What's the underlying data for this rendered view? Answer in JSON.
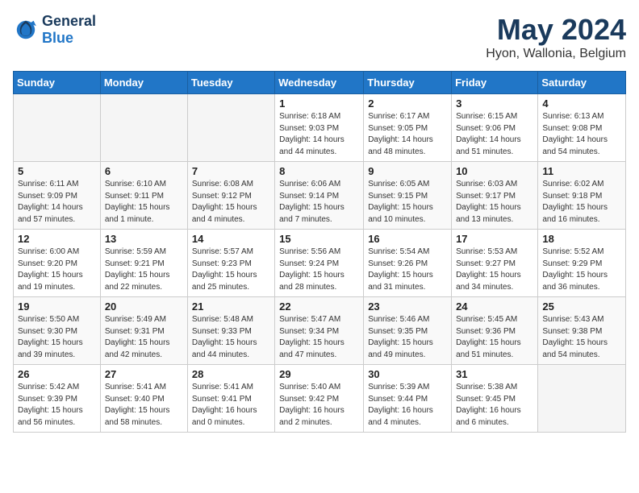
{
  "header": {
    "logo_general": "General",
    "logo_blue": "Blue",
    "month_title": "May 2024",
    "location": "Hyon, Wallonia, Belgium"
  },
  "weekdays": [
    "Sunday",
    "Monday",
    "Tuesday",
    "Wednesday",
    "Thursday",
    "Friday",
    "Saturday"
  ],
  "weeks": [
    [
      {
        "day": "",
        "info": ""
      },
      {
        "day": "",
        "info": ""
      },
      {
        "day": "",
        "info": ""
      },
      {
        "day": "1",
        "info": "Sunrise: 6:18 AM\nSunset: 9:03 PM\nDaylight: 14 hours\nand 44 minutes."
      },
      {
        "day": "2",
        "info": "Sunrise: 6:17 AM\nSunset: 9:05 PM\nDaylight: 14 hours\nand 48 minutes."
      },
      {
        "day": "3",
        "info": "Sunrise: 6:15 AM\nSunset: 9:06 PM\nDaylight: 14 hours\nand 51 minutes."
      },
      {
        "day": "4",
        "info": "Sunrise: 6:13 AM\nSunset: 9:08 PM\nDaylight: 14 hours\nand 54 minutes."
      }
    ],
    [
      {
        "day": "5",
        "info": "Sunrise: 6:11 AM\nSunset: 9:09 PM\nDaylight: 14 hours\nand 57 minutes."
      },
      {
        "day": "6",
        "info": "Sunrise: 6:10 AM\nSunset: 9:11 PM\nDaylight: 15 hours\nand 1 minute."
      },
      {
        "day": "7",
        "info": "Sunrise: 6:08 AM\nSunset: 9:12 PM\nDaylight: 15 hours\nand 4 minutes."
      },
      {
        "day": "8",
        "info": "Sunrise: 6:06 AM\nSunset: 9:14 PM\nDaylight: 15 hours\nand 7 minutes."
      },
      {
        "day": "9",
        "info": "Sunrise: 6:05 AM\nSunset: 9:15 PM\nDaylight: 15 hours\nand 10 minutes."
      },
      {
        "day": "10",
        "info": "Sunrise: 6:03 AM\nSunset: 9:17 PM\nDaylight: 15 hours\nand 13 minutes."
      },
      {
        "day": "11",
        "info": "Sunrise: 6:02 AM\nSunset: 9:18 PM\nDaylight: 15 hours\nand 16 minutes."
      }
    ],
    [
      {
        "day": "12",
        "info": "Sunrise: 6:00 AM\nSunset: 9:20 PM\nDaylight: 15 hours\nand 19 minutes."
      },
      {
        "day": "13",
        "info": "Sunrise: 5:59 AM\nSunset: 9:21 PM\nDaylight: 15 hours\nand 22 minutes."
      },
      {
        "day": "14",
        "info": "Sunrise: 5:57 AM\nSunset: 9:23 PM\nDaylight: 15 hours\nand 25 minutes."
      },
      {
        "day": "15",
        "info": "Sunrise: 5:56 AM\nSunset: 9:24 PM\nDaylight: 15 hours\nand 28 minutes."
      },
      {
        "day": "16",
        "info": "Sunrise: 5:54 AM\nSunset: 9:26 PM\nDaylight: 15 hours\nand 31 minutes."
      },
      {
        "day": "17",
        "info": "Sunrise: 5:53 AM\nSunset: 9:27 PM\nDaylight: 15 hours\nand 34 minutes."
      },
      {
        "day": "18",
        "info": "Sunrise: 5:52 AM\nSunset: 9:29 PM\nDaylight: 15 hours\nand 36 minutes."
      }
    ],
    [
      {
        "day": "19",
        "info": "Sunrise: 5:50 AM\nSunset: 9:30 PM\nDaylight: 15 hours\nand 39 minutes."
      },
      {
        "day": "20",
        "info": "Sunrise: 5:49 AM\nSunset: 9:31 PM\nDaylight: 15 hours\nand 42 minutes."
      },
      {
        "day": "21",
        "info": "Sunrise: 5:48 AM\nSunset: 9:33 PM\nDaylight: 15 hours\nand 44 minutes."
      },
      {
        "day": "22",
        "info": "Sunrise: 5:47 AM\nSunset: 9:34 PM\nDaylight: 15 hours\nand 47 minutes."
      },
      {
        "day": "23",
        "info": "Sunrise: 5:46 AM\nSunset: 9:35 PM\nDaylight: 15 hours\nand 49 minutes."
      },
      {
        "day": "24",
        "info": "Sunrise: 5:45 AM\nSunset: 9:36 PM\nDaylight: 15 hours\nand 51 minutes."
      },
      {
        "day": "25",
        "info": "Sunrise: 5:43 AM\nSunset: 9:38 PM\nDaylight: 15 hours\nand 54 minutes."
      }
    ],
    [
      {
        "day": "26",
        "info": "Sunrise: 5:42 AM\nSunset: 9:39 PM\nDaylight: 15 hours\nand 56 minutes."
      },
      {
        "day": "27",
        "info": "Sunrise: 5:41 AM\nSunset: 9:40 PM\nDaylight: 15 hours\nand 58 minutes."
      },
      {
        "day": "28",
        "info": "Sunrise: 5:41 AM\nSunset: 9:41 PM\nDaylight: 16 hours\nand 0 minutes."
      },
      {
        "day": "29",
        "info": "Sunrise: 5:40 AM\nSunset: 9:42 PM\nDaylight: 16 hours\nand 2 minutes."
      },
      {
        "day": "30",
        "info": "Sunrise: 5:39 AM\nSunset: 9:44 PM\nDaylight: 16 hours\nand 4 minutes."
      },
      {
        "day": "31",
        "info": "Sunrise: 5:38 AM\nSunset: 9:45 PM\nDaylight: 16 hours\nand 6 minutes."
      },
      {
        "day": "",
        "info": ""
      }
    ]
  ]
}
